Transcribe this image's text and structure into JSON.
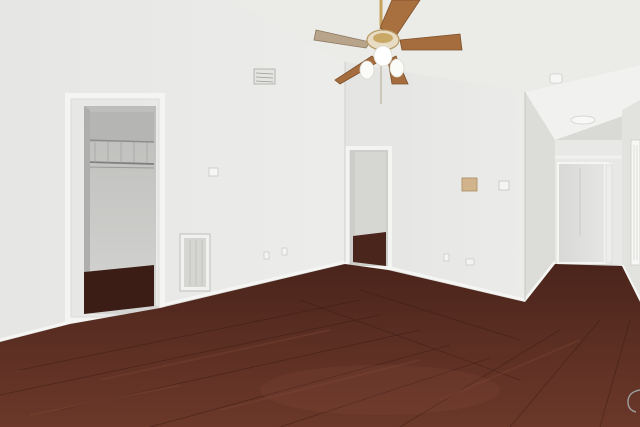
{
  "scene": {
    "kind": "photo",
    "subject": "empty-room-interior",
    "colors": {
      "wall": "#e9e9e7",
      "wall_shadow": "#d4d5d3",
      "ceiling": "#ececea",
      "floor_dark": "#3a1c15",
      "floor_mid": "#5a2e22",
      "floor_light": "#7a4535",
      "trim": "#f3f3f1",
      "fan_blade": "#a06a3c",
      "closet_interior": "#c9cac7"
    }
  }
}
